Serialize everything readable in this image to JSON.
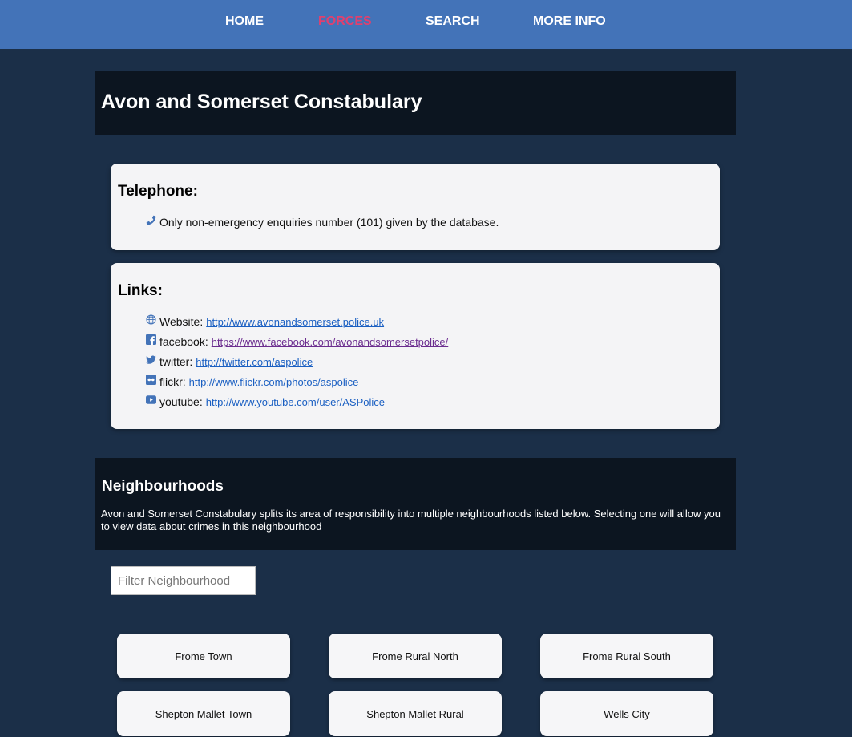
{
  "nav": {
    "items": [
      {
        "label": "HOME"
      },
      {
        "label": "FORCES"
      },
      {
        "label": "SEARCH"
      },
      {
        "label": "MORE INFO"
      }
    ],
    "active_color": "#e0406f",
    "bar_color": "#4373b8"
  },
  "force": {
    "name": "Avon and Somerset Constabulary"
  },
  "telephone": {
    "heading": "Telephone:",
    "icon": "phone-icon",
    "text": "Only non-emergency enquiries number (101) given by the database."
  },
  "links": {
    "heading": "Links:",
    "items": [
      {
        "icon": "globe-icon",
        "label": "Website:",
        "url": "http://www.avonandsomerset.police.uk"
      },
      {
        "icon": "facebook-icon",
        "label": "facebook:",
        "url": "https://www.facebook.com/avonandsomersetpolice/"
      },
      {
        "icon": "twitter-icon",
        "label": "twitter:",
        "url": "http://twitter.com/aspolice"
      },
      {
        "icon": "flickr-icon",
        "label": "flickr:",
        "url": "http://www.flickr.com/photos/aspolice"
      },
      {
        "icon": "youtube-icon",
        "label": "youtube:",
        "url": "http://www.youtube.com/user/ASPolice"
      }
    ]
  },
  "neighbourhoods": {
    "heading": "Neighbourhoods",
    "description": "Avon and Somerset Constabulary splits its area of responsibility into multiple neighbourhoods listed below. Selecting one will allow you to view data about crimes in this neighbourhood",
    "filter_placeholder": "Filter Neighbourhood",
    "filter_value": "",
    "items": [
      {
        "name": "Frome Town"
      },
      {
        "name": "Frome Rural North"
      },
      {
        "name": "Frome Rural South"
      },
      {
        "name": "Shepton Mallet Town"
      },
      {
        "name": "Shepton Mallet Rural"
      },
      {
        "name": "Wells City"
      }
    ]
  }
}
